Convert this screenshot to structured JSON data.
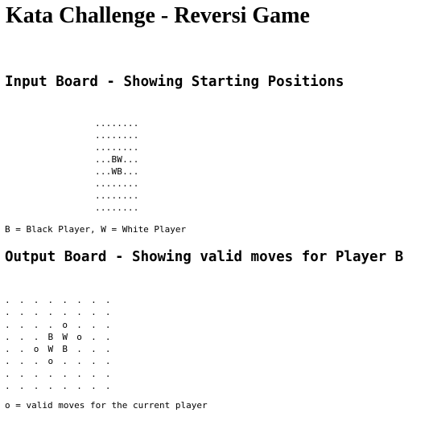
{
  "title": "Kata Challenge - Reversi Game",
  "input": {
    "heading": "Input Board - Showing Starting Positions",
    "board": [
      "........",
      "........",
      "........",
      "...BW...",
      "...WB...",
      "........",
      "........",
      "........"
    ],
    "legend": "B = Black Player, W = White Player"
  },
  "output": {
    "heading": "Output Board - Showing valid moves for Player B",
    "board": [
      ". . . . . . . .",
      ". . . . . . . .",
      ". . . . o . . .",
      ". . . B W o . .",
      ". . o W B . . .",
      ". . . o . . . .",
      ". . . . . . . .",
      ". . . . . . . ."
    ],
    "legend": "o = valid moves for the current player"
  }
}
